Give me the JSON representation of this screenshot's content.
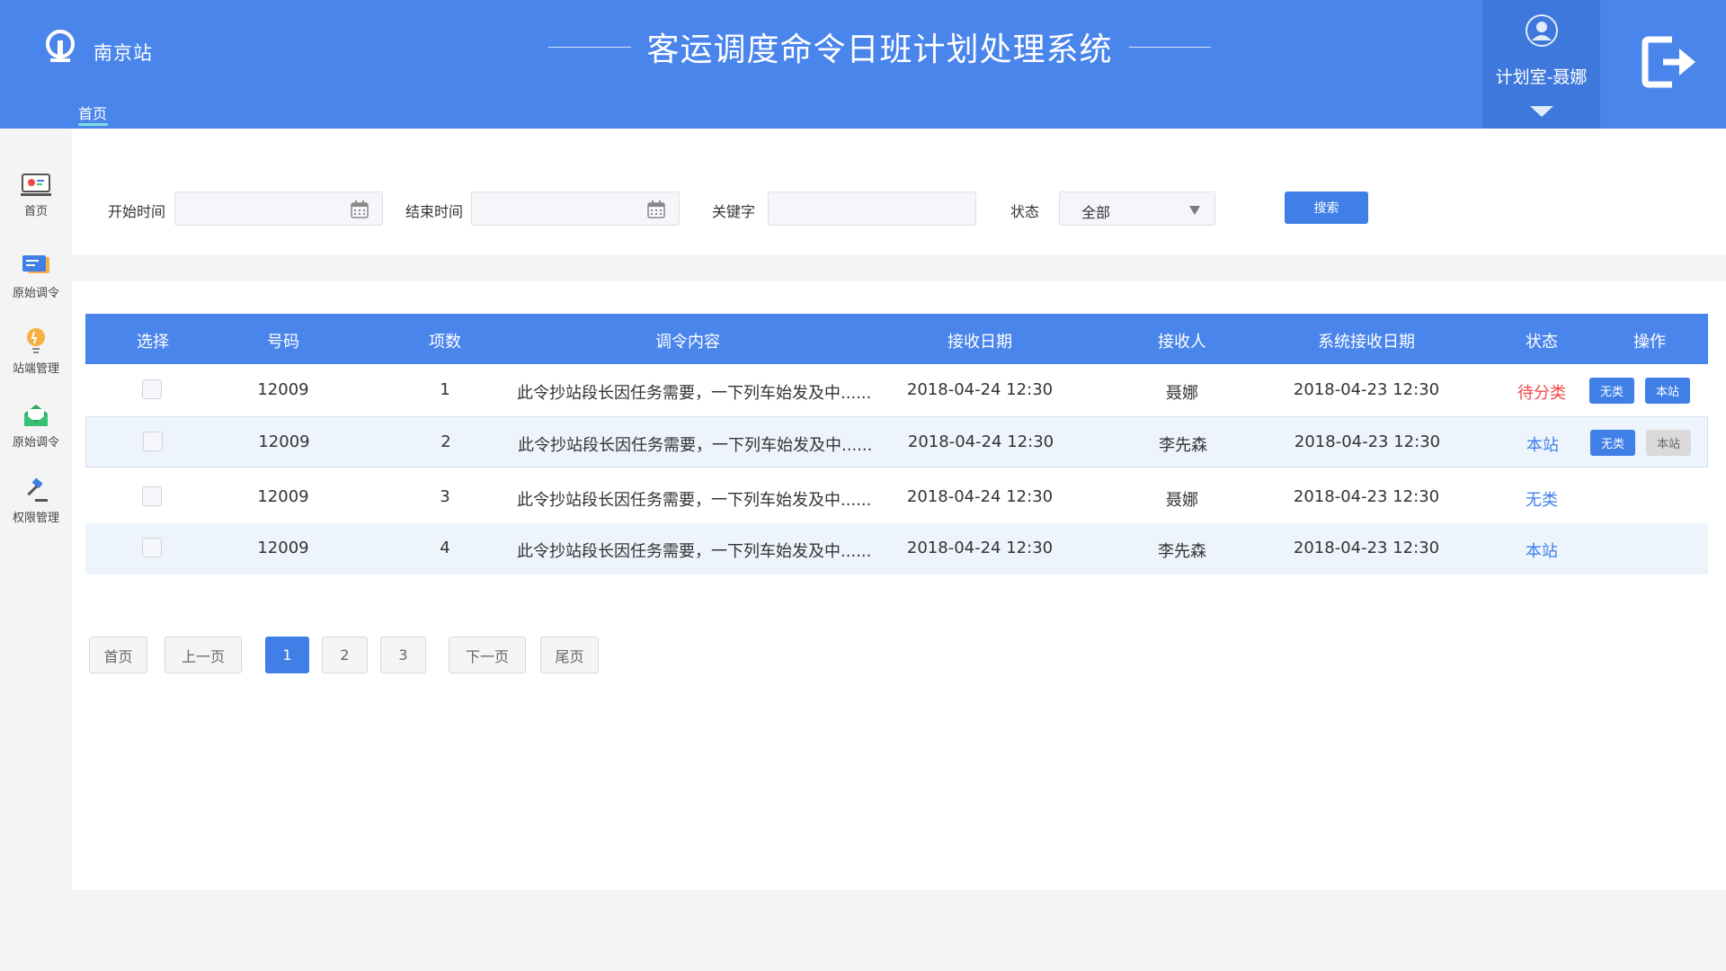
{
  "header": {
    "station_name": "南京站",
    "title": "客运调度命令日班计划处理系统",
    "nav_home": "首页",
    "user_name": "计划室-聂娜"
  },
  "sidebar": {
    "items": [
      {
        "label": "首页",
        "icon": "monitor-icon"
      },
      {
        "label": "原始调令",
        "icon": "message-icon"
      },
      {
        "label": "站端管理",
        "icon": "bulb-icon"
      },
      {
        "label": "原始调令",
        "icon": "mail-icon"
      },
      {
        "label": "权限管理",
        "icon": "gavel-icon"
      }
    ]
  },
  "search": {
    "start_label": "开始时间",
    "start_value": "",
    "end_label": "结束时间",
    "end_value": "",
    "keyword_label": "关键字",
    "keyword_value": "",
    "status_label": "状态",
    "status_value": "全部",
    "search_button": "搜索"
  },
  "table": {
    "headers": [
      "选择",
      "号码",
      "项数",
      "调令内容",
      "接收日期",
      "接收人",
      "系统接收日期",
      "状态",
      "操作"
    ],
    "rows": [
      {
        "number": "12009",
        "items": "1",
        "content": "此令抄站段长因任务需要，一下列车始发及中......",
        "recv_date": "2018-04-24  12:30",
        "receiver": "聂娜",
        "sys_date": "2018-04-23  12:30",
        "status": "待分类",
        "status_color": "#f04848",
        "ops": [
          "无类",
          "本站"
        ]
      },
      {
        "number": "12009",
        "items": "2",
        "content": "此令抄站段长因任务需要，一下列车始发及中......",
        "recv_date": "2018-04-24  12:30",
        "receiver": "李先森",
        "sys_date": "2018-04-23  12:30",
        "status": "本站",
        "status_color": "#3f7fe6",
        "ops": [
          "无类",
          "本站"
        ]
      },
      {
        "number": "12009",
        "items": "3",
        "content": "此令抄站段长因任务需要，一下列车始发及中......",
        "recv_date": "2018-04-24  12:30",
        "receiver": "聂娜",
        "sys_date": "2018-04-23  12:30",
        "status": "无类",
        "status_color": "#3f7fe6",
        "ops": []
      },
      {
        "number": "12009",
        "items": "4",
        "content": "此令抄站段长因任务需要，一下列车始发及中......",
        "recv_date": "2018-04-24  12:30",
        "receiver": "李先森",
        "sys_date": "2018-04-23  12:30",
        "status": "本站",
        "status_color": "#3f7fe6",
        "ops": []
      }
    ]
  },
  "pagination": {
    "first": "首页",
    "prev": "上一页",
    "pages": [
      "1",
      "2",
      "3"
    ],
    "current": "1",
    "next": "下一页",
    "last": "尾页"
  },
  "colors": {
    "header_blue": "#4a85ec",
    "accent_blue": "#3f7fe6",
    "status_red": "#f04848"
  }
}
